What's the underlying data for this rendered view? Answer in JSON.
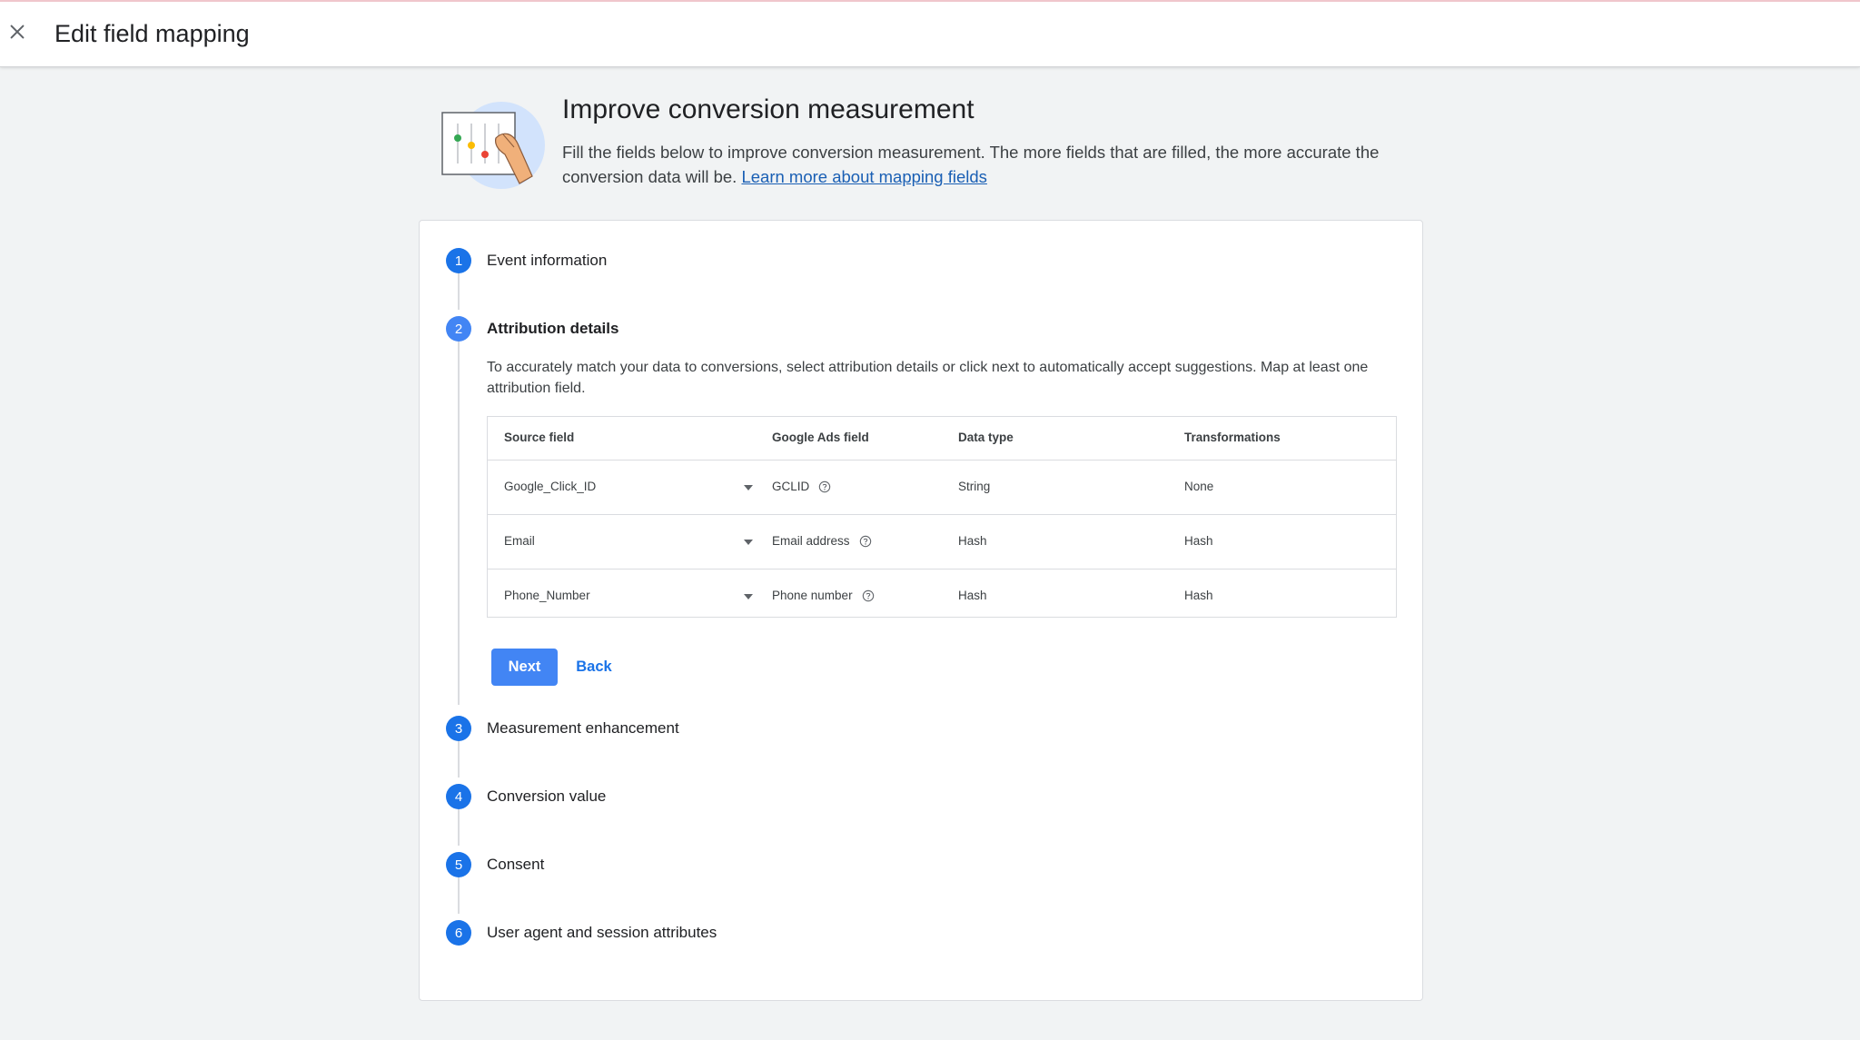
{
  "header": {
    "close_icon": "close-icon",
    "title": "Edit field mapping"
  },
  "intro": {
    "illustration": "sliders-hand-illustration",
    "title": "Improve conversion measurement",
    "description": "Fill the fields below to improve conversion measurement. The more fields that are filled, the more accurate the conversion data will be.",
    "link_text": "Learn more about mapping fields"
  },
  "steps": [
    {
      "number": "1",
      "label": "Event information"
    },
    {
      "number": "2",
      "label": "Attribution details",
      "active": true
    },
    {
      "number": "3",
      "label": "Measurement enhancement"
    },
    {
      "number": "4",
      "label": "Conversion value"
    },
    {
      "number": "5",
      "label": "Consent"
    },
    {
      "number": "6",
      "label": "User agent and session attributes"
    }
  ],
  "attribution": {
    "description": "To accurately match your data to conversions, select attribution details or click next to automatically accept suggestions. Map at least one attribution field.",
    "table": {
      "headers": [
        "Source field",
        "Google Ads field",
        "Data type",
        "Transformations"
      ],
      "rows": [
        {
          "source": "Google_Click_ID",
          "ads_field": "GCLID",
          "data_type": "String",
          "transformation": "None"
        },
        {
          "source": "Email",
          "ads_field": "Email address",
          "data_type": "Hash",
          "transformation": "Hash"
        },
        {
          "source": "Phone_Number",
          "ads_field": "Phone number",
          "data_type": "Hash",
          "transformation": "Hash"
        }
      ]
    },
    "next_label": "Next",
    "back_label": "Back"
  },
  "colors": {
    "primary": "#1a73e8",
    "next_button": "#4285f4",
    "link": "#1a5fb4",
    "page_background": "#f1f3f4"
  }
}
